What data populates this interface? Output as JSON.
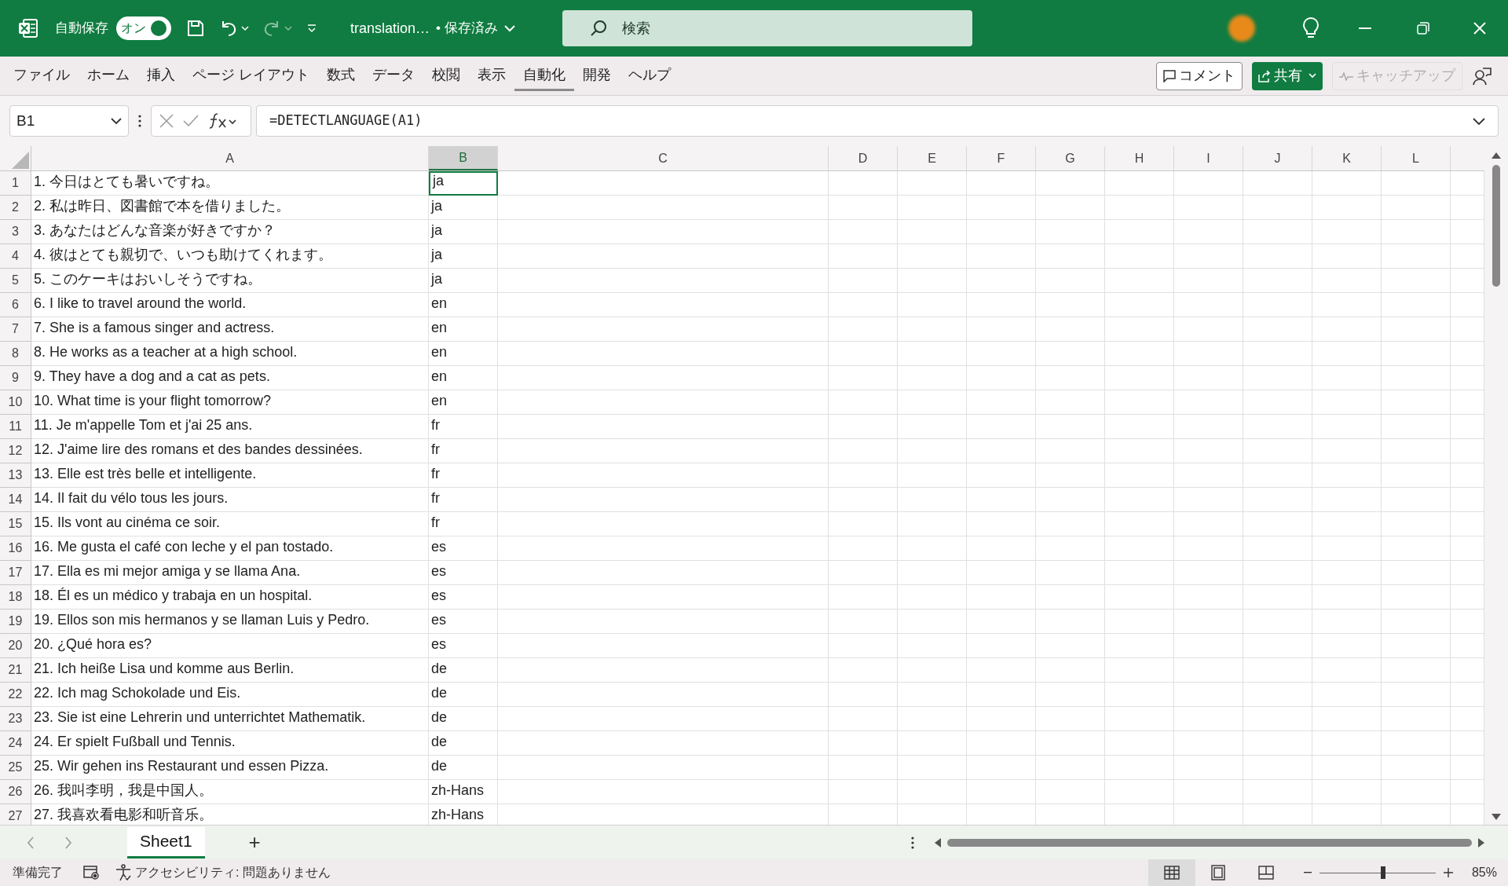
{
  "title_bar": {
    "autosave_label": "自動保存",
    "autosave_toggle": {
      "label": "オン",
      "on": true
    },
    "file_name": "translation…",
    "save_state": "• 保存済み",
    "search_placeholder": "検索"
  },
  "ribbon_tabs": [
    {
      "label": "ファイル",
      "selected": false
    },
    {
      "label": "ホーム",
      "selected": false
    },
    {
      "label": "挿入",
      "selected": false
    },
    {
      "label": "ページ レイアウト",
      "selected": false
    },
    {
      "label": "数式",
      "selected": false
    },
    {
      "label": "データ",
      "selected": false
    },
    {
      "label": "校閲",
      "selected": false
    },
    {
      "label": "表示",
      "selected": false
    },
    {
      "label": "自動化",
      "selected": true
    },
    {
      "label": "開発",
      "selected": false
    },
    {
      "label": "ヘルプ",
      "selected": false
    }
  ],
  "ribbon_buttons": [
    {
      "label": "コメント",
      "kind": "comment",
      "disabled": false
    },
    {
      "label": "共有",
      "kind": "share",
      "disabled": false
    },
    {
      "label": "キャッチアップ",
      "kind": "catchup",
      "disabled": true
    }
  ],
  "formula_bar": {
    "name_box": "B1",
    "formula": "=DETECTLANGUAGE(A1)"
  },
  "columns": [
    {
      "label": "A",
      "selected": false
    },
    {
      "label": "B",
      "selected": true
    },
    {
      "label": "C",
      "selected": false
    },
    {
      "label": "D",
      "selected": false
    },
    {
      "label": "E",
      "selected": false
    },
    {
      "label": "F",
      "selected": false
    },
    {
      "label": "G",
      "selected": false
    },
    {
      "label": "H",
      "selected": false
    },
    {
      "label": "I",
      "selected": false
    },
    {
      "label": "J",
      "selected": false
    },
    {
      "label": "K",
      "selected": false
    },
    {
      "label": "L",
      "selected": false
    }
  ],
  "rows": [
    {
      "number": "1",
      "a": "1. 今日はとても暑いですね。",
      "b": "ja",
      "selected": true
    },
    {
      "number": "2",
      "a": "2. 私は昨日、図書館で本を借りました。",
      "b": "ja",
      "selected": false
    },
    {
      "number": "3",
      "a": "3. あなたはどんな音楽が好きですか？",
      "b": "ja",
      "selected": false
    },
    {
      "number": "4",
      "a": "4. 彼はとても親切で、いつも助けてくれます。",
      "b": "ja",
      "selected": false
    },
    {
      "number": "5",
      "a": "5. このケーキはおいしそうですね。",
      "b": "ja",
      "selected": false
    },
    {
      "number": "6",
      "a": "6. I like to travel around the world.",
      "b": "en",
      "selected": false
    },
    {
      "number": "7",
      "a": "7. She is a famous singer and actress.",
      "b": "en",
      "selected": false
    },
    {
      "number": "8",
      "a": "8. He works as a teacher at a high school.",
      "b": "en",
      "selected": false
    },
    {
      "number": "9",
      "a": "9. They have a dog and a cat as pets.",
      "b": "en",
      "selected": false
    },
    {
      "number": "10",
      "a": "10. What time is your flight tomorrow?",
      "b": "en",
      "selected": false
    },
    {
      "number": "11",
      "a": "11. Je m'appelle Tom et j'ai 25 ans.",
      "b": "fr",
      "selected": false
    },
    {
      "number": "12",
      "a": "12. J'aime lire des romans et des bandes dessinées.",
      "b": "fr",
      "selected": false
    },
    {
      "number": "13",
      "a": "13. Elle est très belle et intelligente.",
      "b": "fr",
      "selected": false
    },
    {
      "number": "14",
      "a": "14. Il fait du vélo tous les jours.",
      "b": "fr",
      "selected": false
    },
    {
      "number": "15",
      "a": "15. Ils vont au cinéma ce soir.",
      "b": "fr",
      "selected": false
    },
    {
      "number": "16",
      "a": "16. Me gusta el café con leche y el pan tostado.",
      "b": "es",
      "selected": false
    },
    {
      "number": "17",
      "a": "17. Ella es mi mejor amiga y se llama Ana.",
      "b": "es",
      "selected": false
    },
    {
      "number": "18",
      "a": "18. Él es un médico y trabaja en un hospital.",
      "b": "es",
      "selected": false
    },
    {
      "number": "19",
      "a": "19. Ellos son mis hermanos y se llaman Luis y Pedro.",
      "b": "es",
      "selected": false
    },
    {
      "number": "20",
      "a": "20. ¿Qué hora es?",
      "b": "es",
      "selected": false
    },
    {
      "number": "21",
      "a": "21. Ich heiße Lisa und komme aus Berlin.",
      "b": "de",
      "selected": false
    },
    {
      "number": "22",
      "a": "22. Ich mag Schokolade und Eis.",
      "b": "de",
      "selected": false
    },
    {
      "number": "23",
      "a": "23. Sie ist eine Lehrerin und unterrichtet Mathematik.",
      "b": "de",
      "selected": false
    },
    {
      "number": "24",
      "a": "24. Er spielt Fußball und Tennis.",
      "b": "de",
      "selected": false
    },
    {
      "number": "25",
      "a": "25. Wir gehen ins Restaurant und essen Pizza.",
      "b": "de",
      "selected": false
    },
    {
      "number": "26",
      "a": "26. 我叫李明，我是中国人。",
      "b": "zh-Hans",
      "selected": false
    },
    {
      "number": "27",
      "a": "27. 我喜欢看电影和听音乐。",
      "b": "zh-Hans",
      "selected": false
    }
  ],
  "sheet_tabs": [
    {
      "label": "Sheet1",
      "selected": true
    }
  ],
  "add_sheet": "+",
  "status_bar": {
    "ready": "準備完了",
    "accessibility": "アクセシビリティ: 問題ありません",
    "zoom": "85%",
    "zoom_slider": {
      "level": 0.55
    }
  }
}
